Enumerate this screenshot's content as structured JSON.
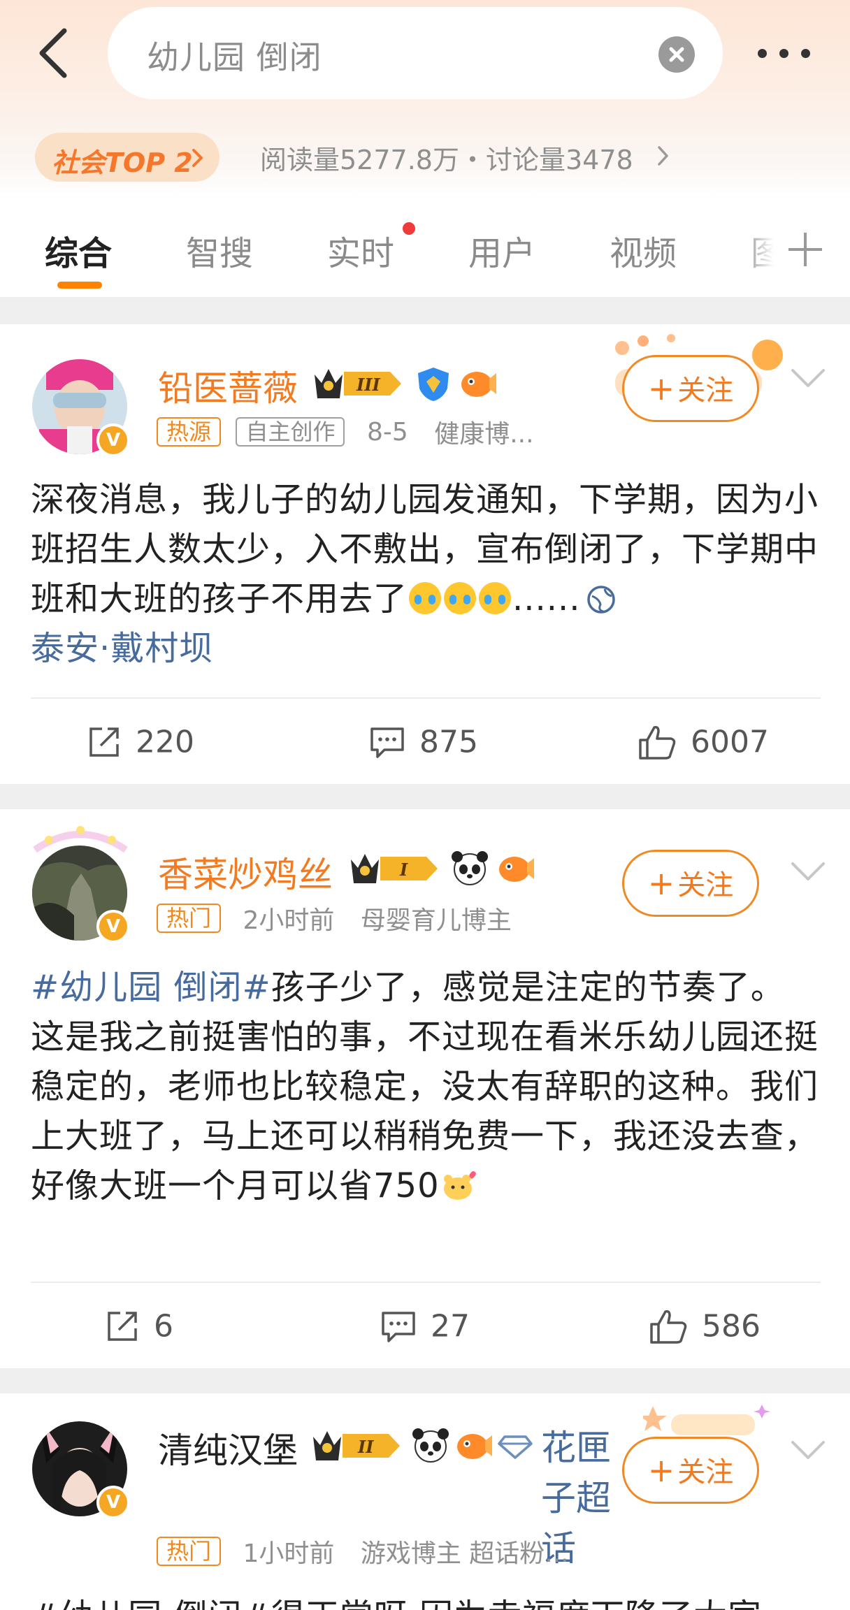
{
  "header": {
    "search_query": "幼儿园 倒闭",
    "rank_badge": "社会TOP 2",
    "stats": "阅读量5277.8万・讨论量3478"
  },
  "tabs": [
    {
      "label": "综合",
      "active": true
    },
    {
      "label": "智搜"
    },
    {
      "label": "实时",
      "has_dot": true
    },
    {
      "label": "用户"
    },
    {
      "label": "视频"
    },
    {
      "label": "图"
    }
  ],
  "posts": [
    {
      "username": "铅医蔷薇",
      "level": "III",
      "tags": [
        "热源",
        "自主创作"
      ],
      "time": "8-5",
      "category": "健康博...",
      "follow_label": "关注",
      "text": "深夜消息，我儿子的幼儿园发通知，下学期，因为小班招生人数太少，入不敷出，宣布倒闭了，下学期中班和大班的孩子不用去了",
      "text_tail": "......",
      "location": "泰安·戴村坝",
      "reposts": "220",
      "comments": "875",
      "likes": "6007"
    },
    {
      "username": "香菜炒鸡丝",
      "level": "I",
      "tags": [
        "热门"
      ],
      "time": "2小时前",
      "category": "母婴育儿博主",
      "follow_label": "关注",
      "hashtag": "#幼儿园 倒闭#",
      "text_1": "孩子少了，感觉是注定的节奏了。",
      "text_2": "这是我之前挺害怕的事，不过现在看米乐幼儿园还挺稳定的，老师也比较稳定，没太有辞职的这种。我们上大班了，马上还可以稍稍免费一下，我还没去查，好像大班一个月可以省750",
      "reposts": "6",
      "comments": "27",
      "likes": "586"
    },
    {
      "username": "清纯汉堡",
      "level": "II",
      "supertopic": "花匣子超话",
      "tags": [
        "热门"
      ],
      "time": "1小时前",
      "category": "游戏博主 超话粉...",
      "follow_label": "关注",
      "text_partial": "#幼儿园 倒闭#得正常呀 因为幸福度下降了大家"
    }
  ],
  "colors": {
    "accent": "#ff8200",
    "username": "#f27a20",
    "link": "#466b9c"
  }
}
